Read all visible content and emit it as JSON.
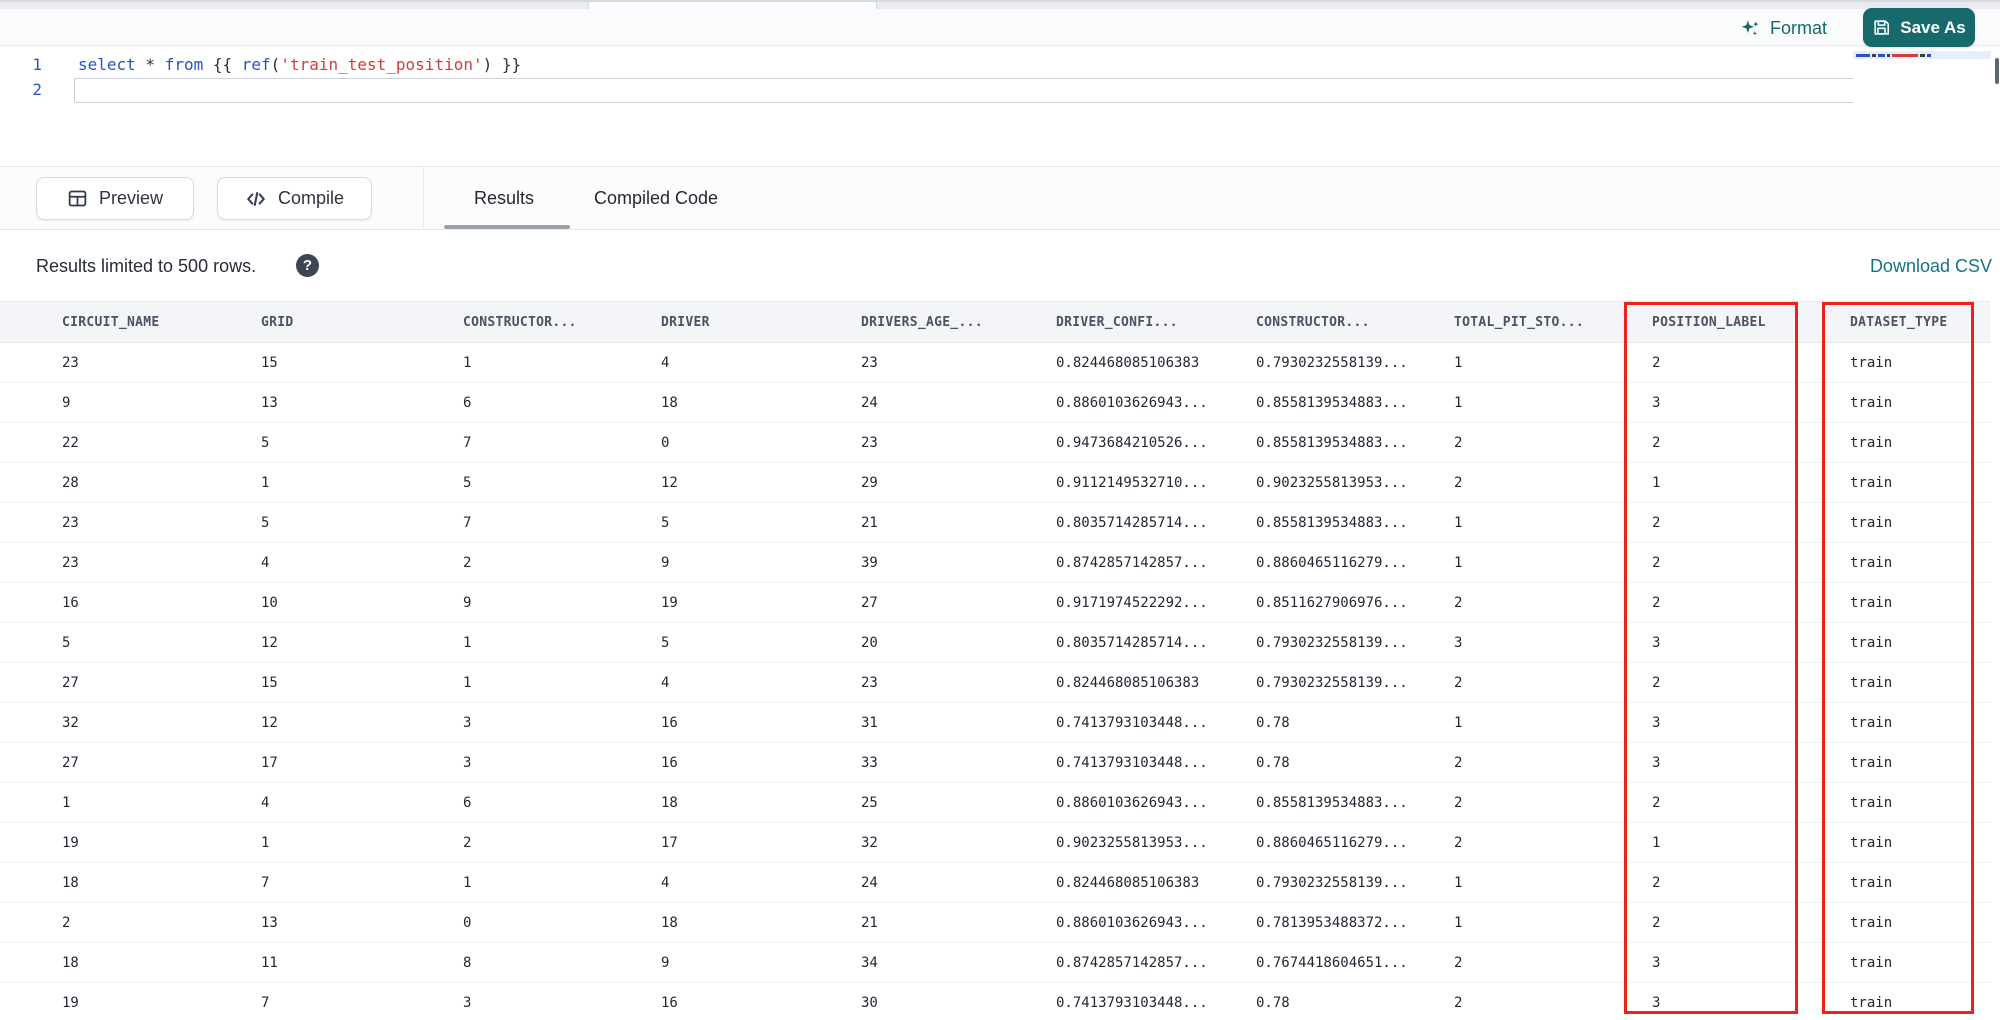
{
  "toolbar": {
    "format_label": "Format",
    "save_as_label": "Save As"
  },
  "editor": {
    "lines": [
      {
        "number": "1",
        "tokens": [
          {
            "text": "select",
            "type": "keyword"
          },
          {
            "text": " * ",
            "type": "plain"
          },
          {
            "text": "from",
            "type": "keyword"
          },
          {
            "text": " {{ ",
            "type": "plain"
          },
          {
            "text": "ref",
            "type": "keyword"
          },
          {
            "text": "(",
            "type": "plain"
          },
          {
            "text": "'train_test_position'",
            "type": "string"
          },
          {
            "text": ")",
            "type": "plain"
          },
          {
            "text": " }}",
            "type": "plain"
          }
        ]
      },
      {
        "number": "2",
        "tokens": []
      }
    ]
  },
  "actions": {
    "preview_label": "Preview",
    "compile_label": "Compile"
  },
  "result_tabs": {
    "results_label": "Results",
    "compiled_code_label": "Compiled Code"
  },
  "results_bar": {
    "limit_note": "Results limited to 500 rows.",
    "download_csv_label": "Download CSV"
  },
  "icons": {
    "help_glyph": "?"
  },
  "table": {
    "columns": [
      "CIRCUIT_NAME",
      "GRID",
      "CONSTRUCTOR...",
      "DRIVER",
      "DRIVERS_AGE_...",
      "DRIVER_CONFI...",
      "CONSTRUCTOR...",
      "TOTAL_PIT_STO...",
      "POSITION_LABEL",
      "DATASET_TYPE"
    ],
    "highlighted_columns": [
      "POSITION_LABEL",
      "DATASET_TYPE"
    ],
    "rows": [
      [
        "23",
        "15",
        "1",
        "4",
        "23",
        "0.824468085106383",
        "0.7930232558139...",
        "1",
        "2",
        "train"
      ],
      [
        "9",
        "13",
        "6",
        "18",
        "24",
        "0.8860103626943...",
        "0.8558139534883...",
        "1",
        "3",
        "train"
      ],
      [
        "22",
        "5",
        "7",
        "0",
        "23",
        "0.9473684210526...",
        "0.8558139534883...",
        "2",
        "2",
        "train"
      ],
      [
        "28",
        "1",
        "5",
        "12",
        "29",
        "0.9112149532710...",
        "0.9023255813953...",
        "2",
        "1",
        "train"
      ],
      [
        "23",
        "5",
        "7",
        "5",
        "21",
        "0.8035714285714...",
        "0.8558139534883...",
        "1",
        "2",
        "train"
      ],
      [
        "23",
        "4",
        "2",
        "9",
        "39",
        "0.8742857142857...",
        "0.8860465116279...",
        "1",
        "2",
        "train"
      ],
      [
        "16",
        "10",
        "9",
        "19",
        "27",
        "0.9171974522292...",
        "0.8511627906976...",
        "2",
        "2",
        "train"
      ],
      [
        "5",
        "12",
        "1",
        "5",
        "20",
        "0.8035714285714...",
        "0.7930232558139...",
        "3",
        "3",
        "train"
      ],
      [
        "27",
        "15",
        "1",
        "4",
        "23",
        "0.824468085106383",
        "0.7930232558139...",
        "2",
        "2",
        "train"
      ],
      [
        "32",
        "12",
        "3",
        "16",
        "31",
        "0.7413793103448...",
        "0.78",
        "1",
        "3",
        "train"
      ],
      [
        "27",
        "17",
        "3",
        "16",
        "33",
        "0.7413793103448...",
        "0.78",
        "2",
        "3",
        "train"
      ],
      [
        "1",
        "4",
        "6",
        "18",
        "25",
        "0.8860103626943...",
        "0.8558139534883...",
        "2",
        "2",
        "train"
      ],
      [
        "19",
        "1",
        "2",
        "17",
        "32",
        "0.9023255813953...",
        "0.8860465116279...",
        "2",
        "1",
        "train"
      ],
      [
        "18",
        "7",
        "1",
        "4",
        "24",
        "0.824468085106383",
        "0.7930232558139...",
        "1",
        "2",
        "train"
      ],
      [
        "2",
        "13",
        "0",
        "18",
        "21",
        "0.8860103626943...",
        "0.7813953488372...",
        "1",
        "2",
        "train"
      ],
      [
        "18",
        "11",
        "8",
        "9",
        "34",
        "0.8742857142857...",
        "0.7674418604651...",
        "2",
        "3",
        "train"
      ],
      [
        "19",
        "7",
        "3",
        "16",
        "30",
        "0.7413793103448...",
        "0.78",
        "2",
        "3",
        "train"
      ]
    ]
  },
  "colors": {
    "accent_teal": "#176a6b",
    "link_teal": "#177386",
    "highlight_red": "#ee201c",
    "keyword_blue": "#2652c6",
    "string_red": "#d63c3a"
  }
}
